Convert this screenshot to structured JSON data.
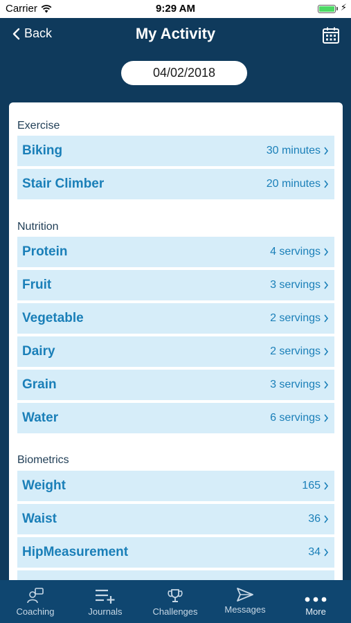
{
  "status": {
    "carrier": "Carrier",
    "time": "9:29 AM"
  },
  "header": {
    "back_label": "Back",
    "title": "My Activity",
    "date": "04/02/2018"
  },
  "sections": [
    {
      "label": "Exercise",
      "items": [
        {
          "name": "Biking",
          "value": "30 minutes"
        },
        {
          "name": "Stair Climber",
          "value": "20 minutes"
        }
      ]
    },
    {
      "label": "Nutrition",
      "items": [
        {
          "name": "Protein",
          "value": "4 servings"
        },
        {
          "name": "Fruit",
          "value": "3 servings"
        },
        {
          "name": "Vegetable",
          "value": "2 servings"
        },
        {
          "name": "Dairy",
          "value": "2 servings"
        },
        {
          "name": "Grain",
          "value": "3 servings"
        },
        {
          "name": "Water",
          "value": "6 servings"
        }
      ]
    },
    {
      "label": "Biometrics",
      "items": [
        {
          "name": "Weight",
          "value": "165"
        },
        {
          "name": "Waist",
          "value": "36"
        },
        {
          "name": "HipMeasurement",
          "value": "34"
        }
      ]
    }
  ],
  "tabs": [
    {
      "label": "Coaching",
      "icon": "coaching-icon"
    },
    {
      "label": "Journals",
      "icon": "journals-icon"
    },
    {
      "label": "Challenges",
      "icon": "trophy-icon"
    },
    {
      "label": "Messages",
      "icon": "send-icon"
    },
    {
      "label": "More",
      "icon": "more-icon"
    }
  ],
  "colors": {
    "header_bg": "#0f3a5c",
    "row_bg": "#d6edf9",
    "row_text": "#1a7fb8",
    "tab_bg": "#0f4670"
  }
}
